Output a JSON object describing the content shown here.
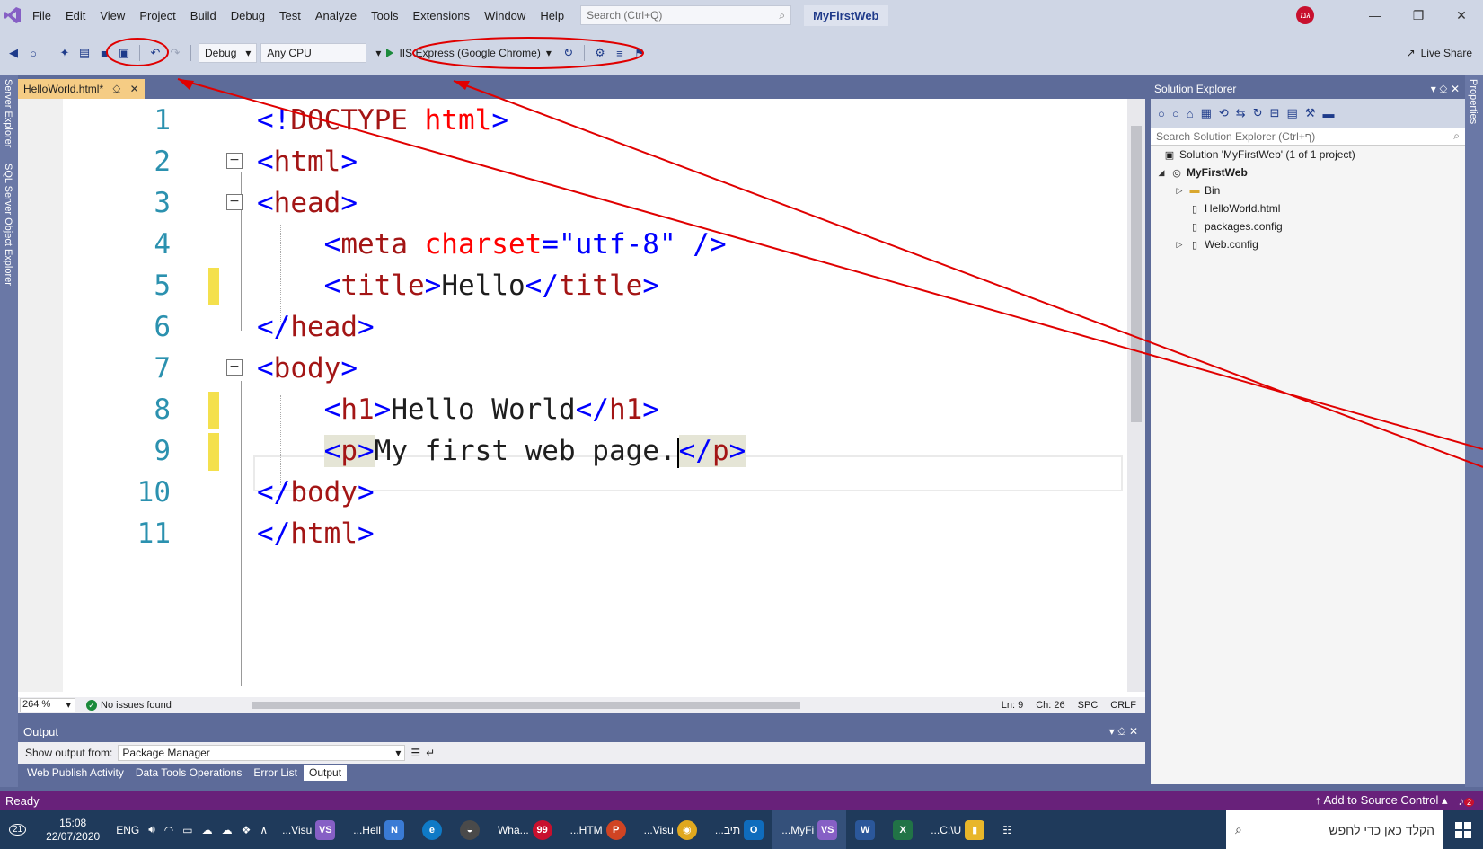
{
  "menubar": {
    "items": [
      "File",
      "Edit",
      "View",
      "Project",
      "Build",
      "Debug",
      "Test",
      "Analyze",
      "Tools",
      "Extensions",
      "Window",
      "Help"
    ],
    "search_placeholder": "Search (Ctrl+Q)",
    "solution_name": "MyFirstWeb",
    "avatar_initials": "גמ"
  },
  "toolbar": {
    "config": "Debug",
    "platform": "Any CPU",
    "run_target": "IIS Express (Google Chrome)",
    "live_share": "Live Share"
  },
  "side_panels": {
    "left": [
      "Server Explorer",
      "SQL Server Object Explorer"
    ],
    "right": [
      "Properties"
    ]
  },
  "document_tab": {
    "name": "HelloWorld.html*"
  },
  "editor": {
    "lines": [
      {
        "n": "1"
      },
      {
        "n": "2"
      },
      {
        "n": "3"
      },
      {
        "n": "4"
      },
      {
        "n": "5"
      },
      {
        "n": "6"
      },
      {
        "n": "7"
      },
      {
        "n": "8"
      },
      {
        "n": "9"
      },
      {
        "n": "10"
      },
      {
        "n": "11"
      }
    ],
    "code": {
      "l1_open": "<!",
      "l1_kw": "DOCTYPE",
      "l1_sp": " ",
      "l1_arg": "html",
      "l1_close": ">",
      "l2_open": "<",
      "l2_name": "html",
      "l2_close": ">",
      "l3_open": "<",
      "l3_name": "head",
      "l3_close": ">",
      "l4_open": "<",
      "l4_name": "meta",
      "l4_attr": " charset",
      "l4_eq": "=",
      "l4_val": "\"utf-8\"",
      "l4_close": " />",
      "l5_open": "<",
      "l5_name": "title",
      "l5_gt": ">",
      "l5_text": "Hello",
      "l5_end_open": "</",
      "l5_end_name": "title",
      "l5_end_close": ">",
      "l6_open": "</",
      "l6_name": "head",
      "l6_close": ">",
      "l7_open": "<",
      "l7_name": "body",
      "l7_close": ">",
      "l8_open": "<",
      "l8_name": "h1",
      "l8_gt": ">",
      "l8_text": "Hello World",
      "l8_end_open": "</",
      "l8_end_name": "h1",
      "l8_end_close": ">",
      "l9_open": "<",
      "l9_name": "p",
      "l9_gt": ">",
      "l9_text": "My first web page.",
      "l9_end_open": "</",
      "l9_end_name": "p",
      "l9_end_close": ">",
      "l10_open": "</",
      "l10_name": "body",
      "l10_close": ">",
      "l11_open": "</",
      "l11_name": "html",
      "l11_close": ">"
    },
    "status": {
      "zoom": "264 %",
      "issues": "No issues found",
      "ln": "Ln: 9",
      "ch": "Ch: 26",
      "spc": "SPC",
      "crlf": "CRLF"
    }
  },
  "output": {
    "title": "Output",
    "show_from_label": "Show output from:",
    "show_from_value": "Package Manager",
    "tabs": [
      "Web Publish Activity",
      "Data Tools Operations",
      "Error List",
      "Output"
    ],
    "active_tab": "Output"
  },
  "solution_explorer": {
    "title": "Solution Explorer",
    "search_placeholder": "Search Solution Explorer (Ctrl+ף)",
    "tree": {
      "solution": "Solution 'MyFirstWeb' (1 of 1 project)",
      "project": "MyFirstWeb",
      "items": [
        "Bin",
        "HelloWorld.html",
        "packages.config",
        "Web.config"
      ]
    }
  },
  "status_bar": {
    "ready": "Ready",
    "source_control": "Add to Source Control",
    "notif_count": "2"
  },
  "taskbar": {
    "time": "15:08",
    "date": "22/07/2020",
    "lang": "ENG",
    "badge": "21",
    "apps": [
      {
        "label": "...Visu",
        "icon": "VS",
        "color": "#865fc5"
      },
      {
        "label": "...Hell",
        "icon": "N",
        "color": "#3a7bd5"
      },
      {
        "label": "",
        "icon": "e",
        "color": "#0f7ac6"
      },
      {
        "label": "",
        "icon": "◒",
        "color": "#4a4a4a"
      },
      {
        "label": "Wha...",
        "icon": "99",
        "color": "#c8102e"
      },
      {
        "label": "...HTM",
        "icon": "P",
        "color": "#d04423"
      },
      {
        "label": "...Visu",
        "icon": "◉",
        "color": "#e0a81f"
      },
      {
        "label": "...תיב",
        "icon": "O",
        "color": "#0f6cbd"
      },
      {
        "label": "...MyFi",
        "icon": "VS",
        "color": "#865fc5"
      },
      {
        "label": "",
        "icon": "W",
        "color": "#2b579a"
      },
      {
        "label": "",
        "icon": "X",
        "color": "#217346"
      },
      {
        "label": "...C:\\U",
        "icon": "▮",
        "color": "#e8b62a"
      }
    ],
    "search_placeholder": "הקלד כאן כדי לחפש"
  },
  "annotation": {
    "color": "#e00000"
  }
}
